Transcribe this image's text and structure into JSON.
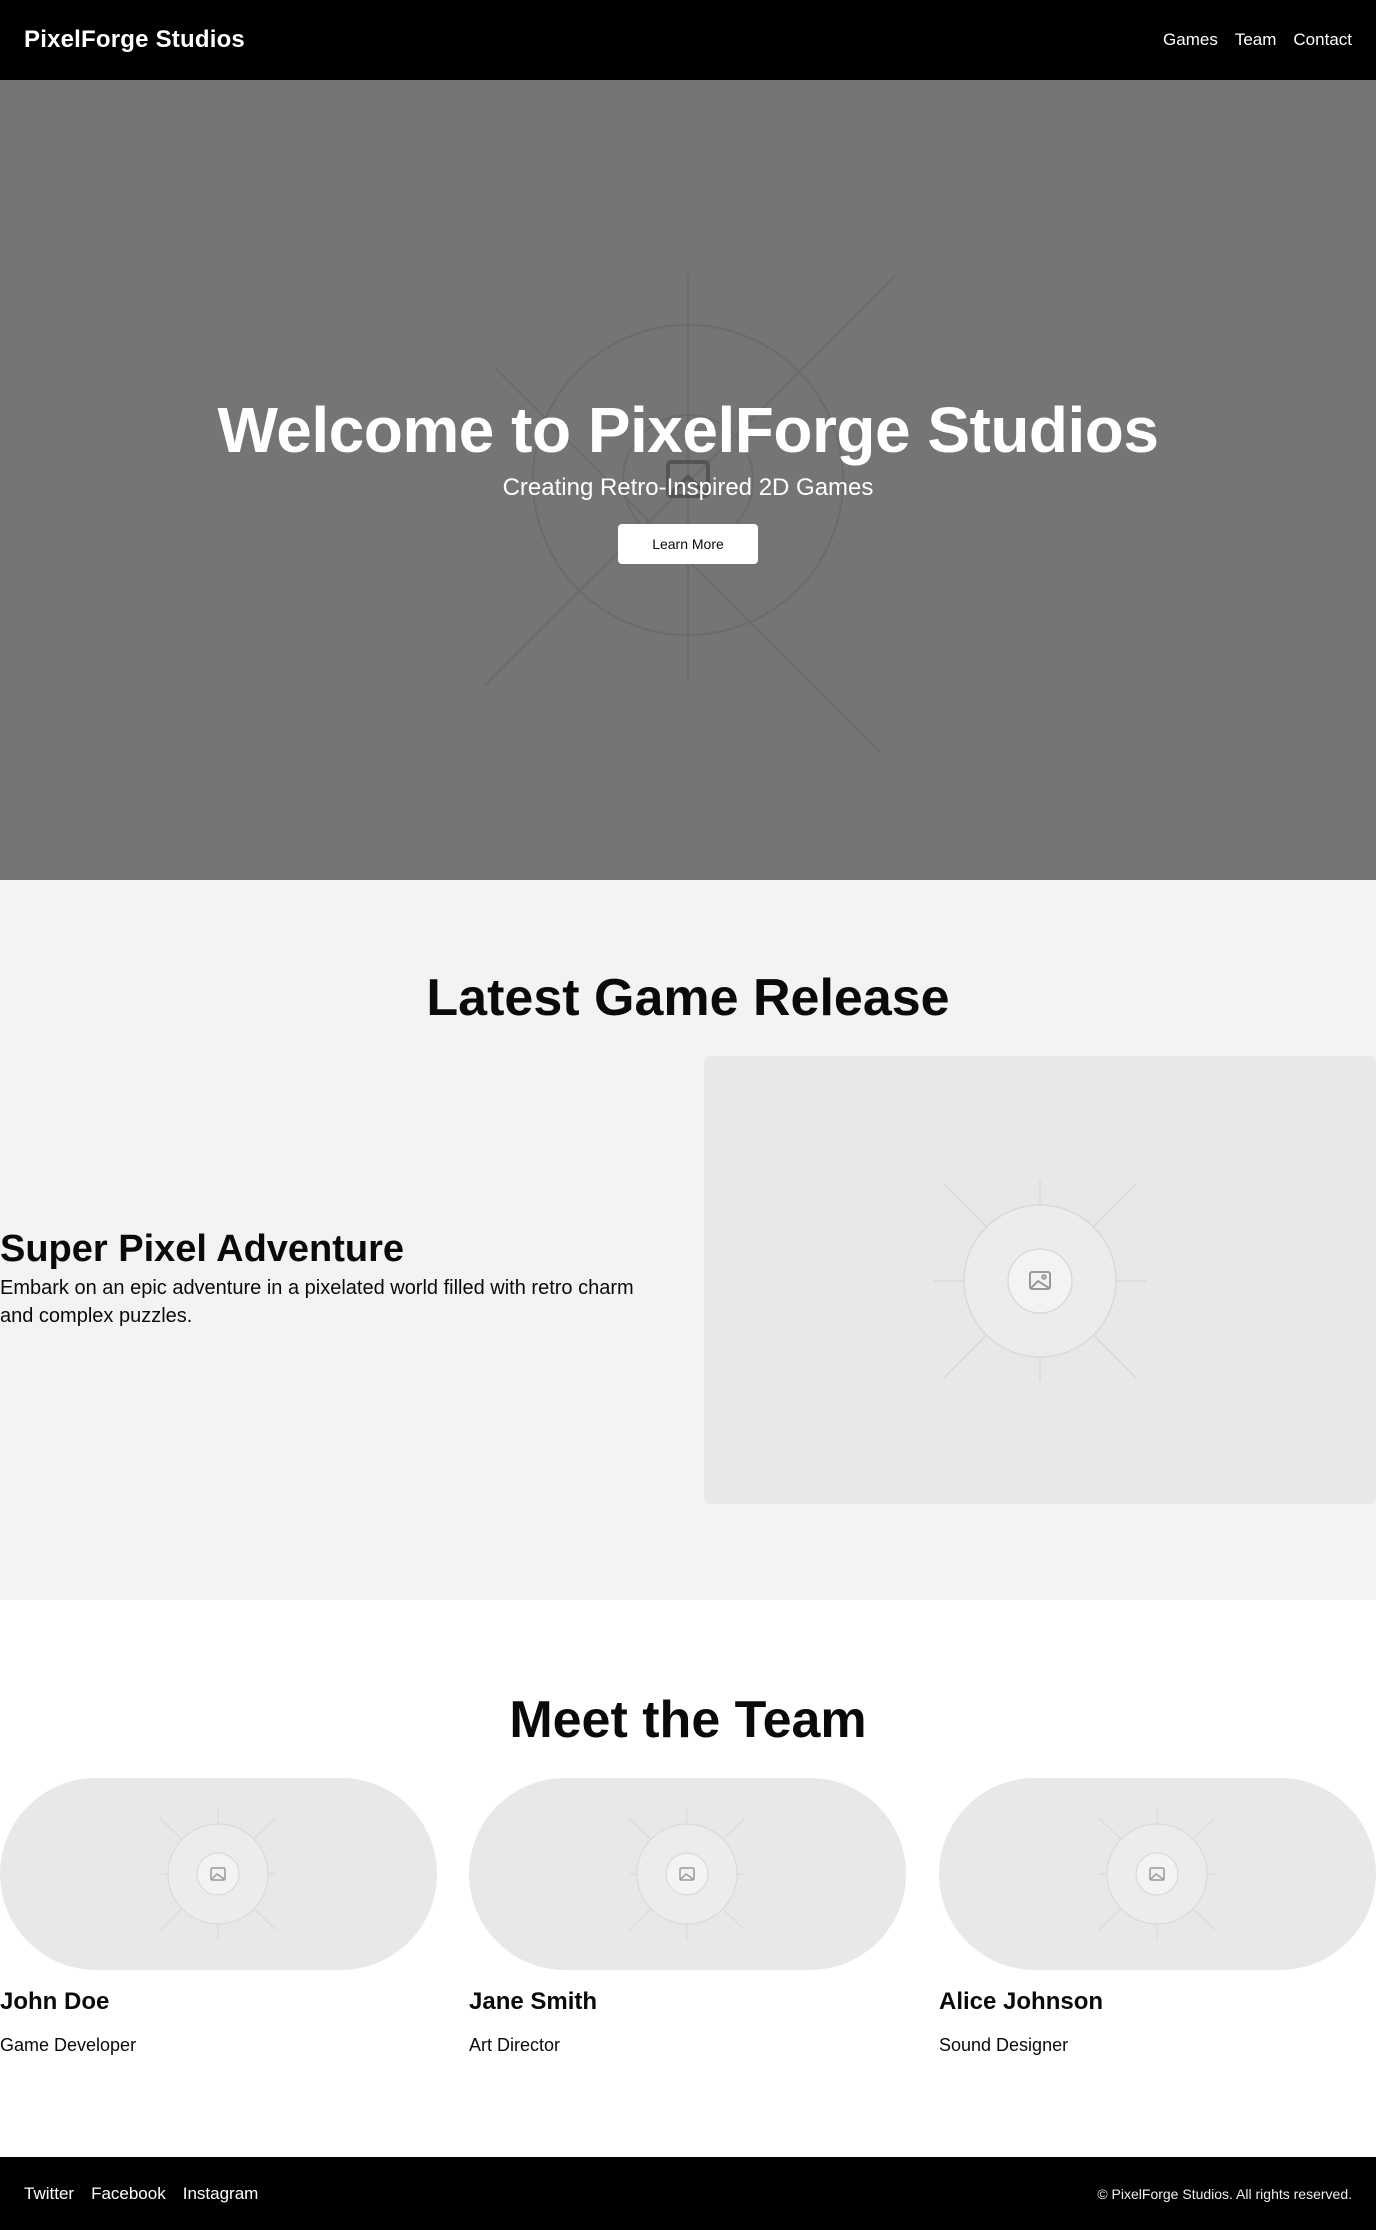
{
  "header": {
    "brand": "PixelForge Studios",
    "nav": [
      "Games",
      "Team",
      "Contact"
    ]
  },
  "hero": {
    "title": "Welcome to PixelForge Studios",
    "subtitle": "Creating Retro-Inspired 2D Games",
    "button_label": "Learn More",
    "background_image_icon": "image-placeholder-icon"
  },
  "latest_release": {
    "heading": "Latest Game Release",
    "game_title": "Super Pixel Adventure",
    "description": "Embark on an epic adventure in a pixelated world filled with retro charm and complex puzzles.",
    "image_icon": "image-placeholder-icon"
  },
  "team": {
    "heading": "Meet the Team",
    "members": [
      {
        "name": "John Doe",
        "role": "Game Developer"
      },
      {
        "name": "Jane Smith",
        "role": "Art Director"
      },
      {
        "name": "Alice Johnson",
        "role": "Sound Designer"
      }
    ]
  },
  "footer": {
    "social": [
      "Twitter",
      "Facebook",
      "Instagram"
    ],
    "copyright": "© PixelForge Studios. All rights reserved."
  },
  "colors": {
    "header_bg": "#000000",
    "hero_bg": "#757575",
    "release_bg": "#f2f3f4",
    "placeholder_bg": "#e8e8e8",
    "text": "#0a0a0a"
  }
}
